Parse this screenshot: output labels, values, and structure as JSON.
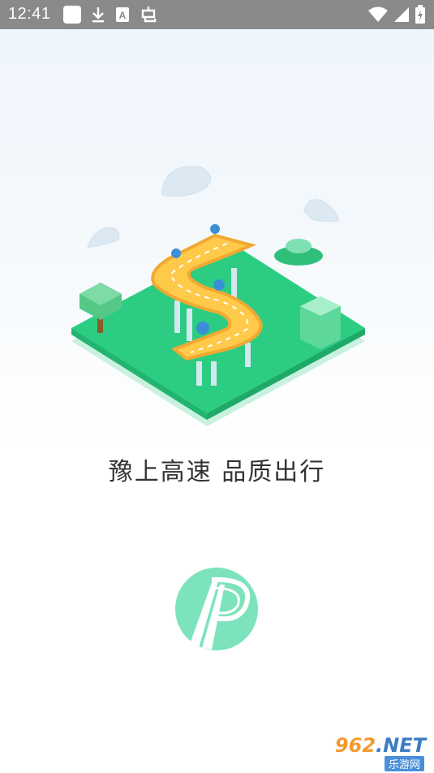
{
  "status_bar": {
    "time": "12:41",
    "left_icons": [
      "app-square-icon",
      "download-icon",
      "a-badge-icon",
      "bug-icon"
    ],
    "right_icons": [
      "wifi-icon",
      "signal-icon",
      "battery-icon"
    ]
  },
  "splash": {
    "slogan": "豫上高速 品质出行",
    "logo_icon": "highway-logo-icon",
    "illustration": "isometric-highway-illustration",
    "colors": {
      "green": "#29c77e",
      "yellow": "#ffc94a",
      "pin_blue": "#3a8fd6"
    }
  },
  "watermark": {
    "number": "962",
    "suffix": ".NET",
    "site_name": "乐游网"
  }
}
